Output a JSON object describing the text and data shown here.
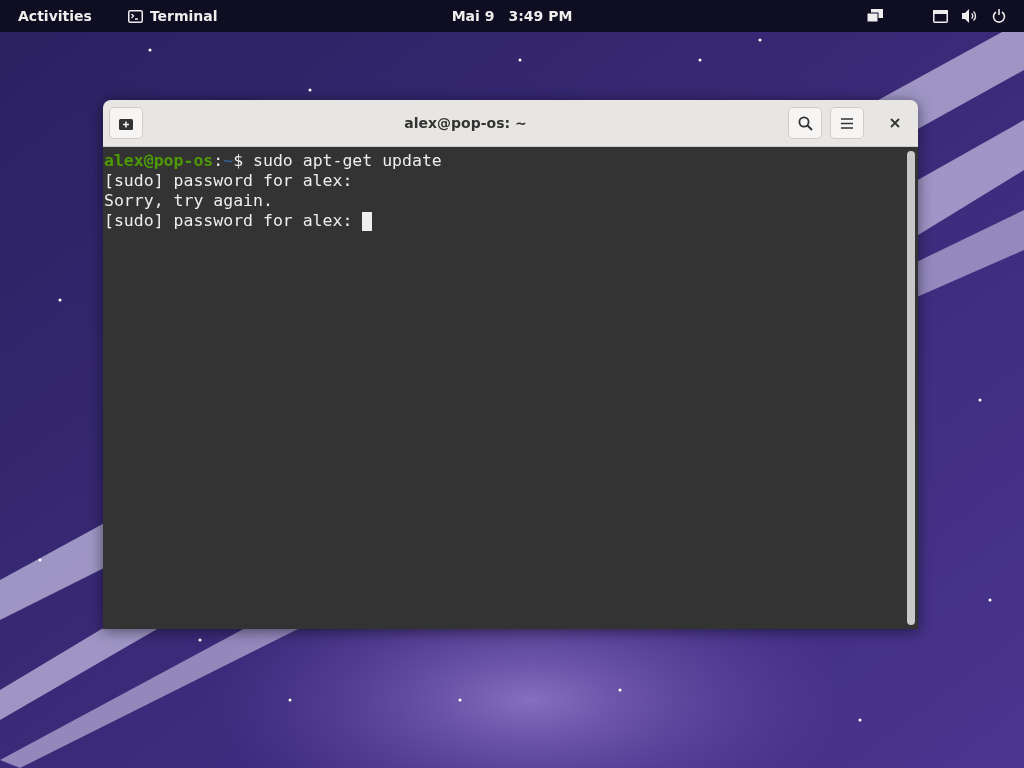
{
  "top_bar": {
    "activities": "Activities",
    "app_menu": "Terminal",
    "date": "Mai 9",
    "time": "3:49 PM"
  },
  "window": {
    "title": "alex@pop-os: ~",
    "lines": [
      {
        "kind": "prompt",
        "user": "alex@pop-os",
        "separator": ":",
        "path": "~",
        "command": "$ sudo apt-get update",
        "cursor": false
      },
      {
        "kind": "output",
        "text": "[sudo] password for alex:",
        "cursor": false
      },
      {
        "kind": "output",
        "text": "Sorry, try again.",
        "cursor": false
      },
      {
        "kind": "output",
        "text": "[sudo] password for alex: ",
        "cursor": true
      }
    ]
  }
}
